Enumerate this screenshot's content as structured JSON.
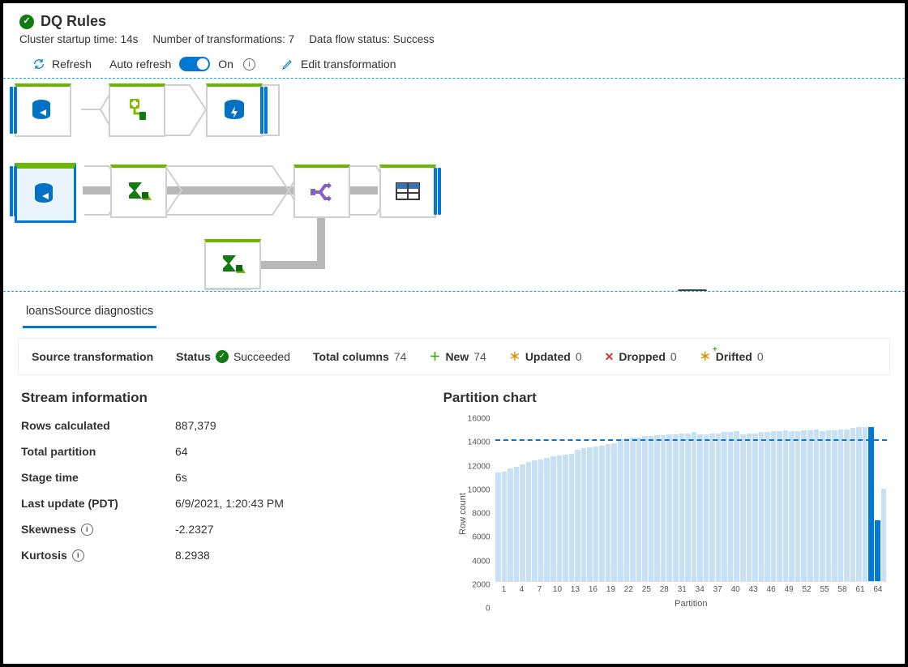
{
  "header": {
    "title": "DQ Rules",
    "meta": {
      "cluster_label": "Cluster startup time:",
      "cluster_value": "14s",
      "transform_label": "Number of transformations:",
      "transform_value": "7",
      "status_label": "Data flow status:",
      "status_value": "Success"
    }
  },
  "toolbar": {
    "refresh": "Refresh",
    "auto_refresh": "Auto refresh",
    "toggle_state": "On",
    "edit": "Edit transformation"
  },
  "diagram": {
    "nodes": {
      "row1": [
        "source",
        "transform-plus",
        "sink-power"
      ],
      "row2": [
        "source-selected",
        "aggregate",
        "split",
        "table"
      ],
      "row3_branch": [
        "aggregate"
      ]
    }
  },
  "diagnostics": {
    "tab": "loansSource diagnostics",
    "summary": {
      "source_label": "Source transformation",
      "status_label": "Status",
      "status_value": "Succeeded",
      "total_columns_label": "Total columns",
      "total_columns": "74",
      "new_label": "New",
      "new": "74",
      "updated_label": "Updated",
      "updated": "0",
      "dropped_label": "Dropped",
      "dropped": "0",
      "drifted_label": "Drifted",
      "drifted": "0"
    },
    "stream": {
      "title": "Stream information",
      "rows_calculated_label": "Rows calculated",
      "rows_calculated": "887,379",
      "total_partition_label": "Total partition",
      "total_partition": "64",
      "stage_time_label": "Stage time",
      "stage_time": "6s",
      "last_update_label": "Last update (PDT)",
      "last_update": "6/9/2021, 1:20:43 PM",
      "skewness_label": "Skewness",
      "skewness": "-2.2327",
      "kurtosis_label": "Kurtosis",
      "kurtosis": "8.2938"
    }
  },
  "chart_data": {
    "type": "bar",
    "title": "Partition chart",
    "xlabel": "Partition",
    "ylabel": "Row count",
    "ylim": [
      0,
      16000
    ],
    "yticks": [
      0,
      2000,
      4000,
      6000,
      8000,
      10000,
      12000,
      14000,
      16000
    ],
    "xticks": [
      1,
      4,
      7,
      10,
      13,
      16,
      19,
      22,
      25,
      28,
      31,
      34,
      37,
      40,
      43,
      46,
      49,
      52,
      55,
      58,
      61,
      64
    ],
    "average": 13865,
    "highlight": [
      62,
      63
    ],
    "values": [
      10700,
      10800,
      11100,
      11300,
      11500,
      11800,
      11900,
      12000,
      12200,
      12300,
      12400,
      12500,
      12600,
      13000,
      13100,
      13200,
      13300,
      13400,
      13500,
      13600,
      14000,
      14100,
      14200,
      14200,
      14300,
      14300,
      14400,
      14400,
      14500,
      14500,
      14600,
      14600,
      14700,
      14500,
      14500,
      14600,
      14600,
      14700,
      14700,
      14800,
      14500,
      14600,
      14600,
      14700,
      14700,
      14800,
      14800,
      14900,
      14800,
      14800,
      14900,
      14900,
      15000,
      14800,
      14900,
      14900,
      15000,
      15000,
      15100,
      15200,
      15200,
      15200,
      6000,
      9100
    ]
  }
}
